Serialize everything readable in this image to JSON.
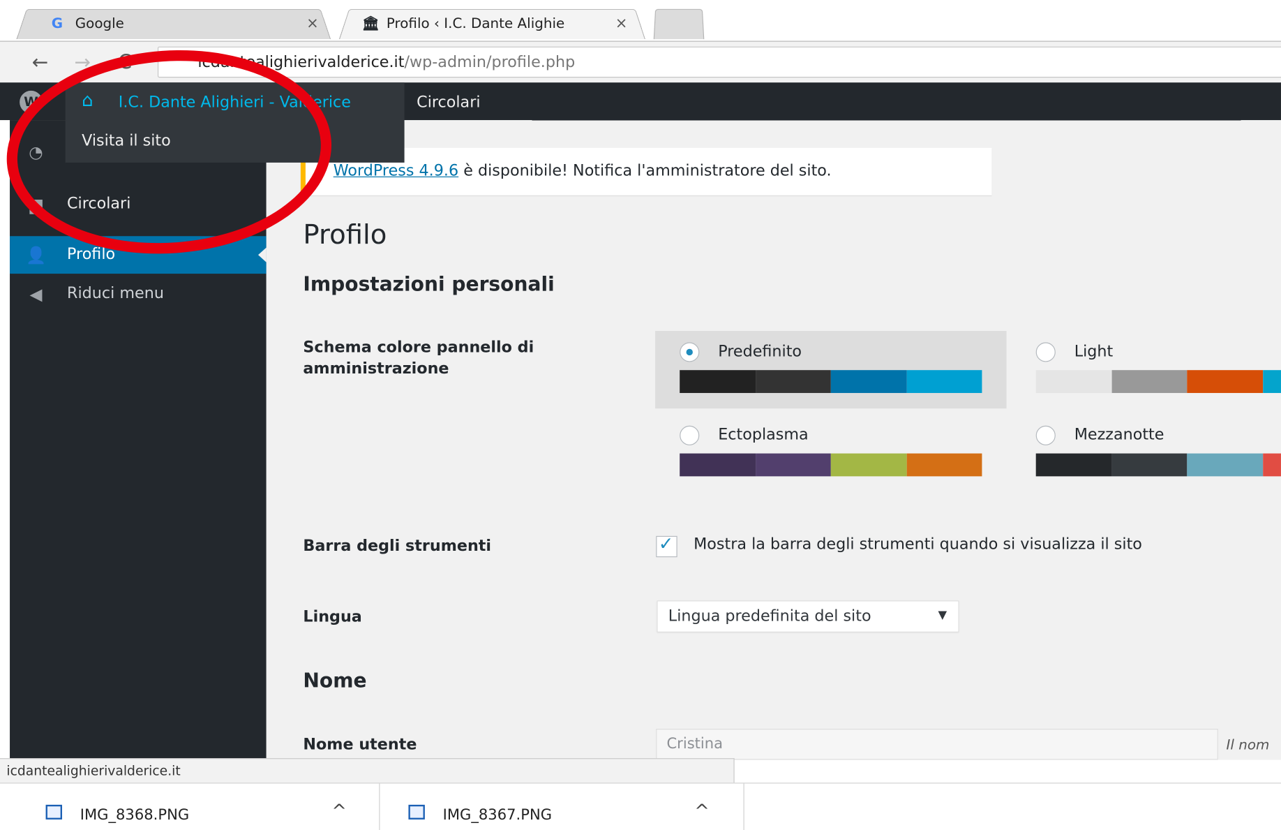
{
  "browser": {
    "tabs": [
      {
        "favicon": "G",
        "title": "Google",
        "close": "×"
      },
      {
        "favicon": "🏛",
        "title": "Profilo ‹ I.C. Dante Alighie",
        "close": "×"
      }
    ],
    "nav": {
      "back": "←",
      "forward": "→",
      "reload": "C"
    },
    "url_host": "icdantealighierivalderice.it",
    "url_path": "/wp-admin/profile.php"
  },
  "adminbar": {
    "wp_logo": "W",
    "site_name": "I.C. Dante Alighieri - Valderice",
    "visit_site": "Visita il sito",
    "circolari": "Circolari"
  },
  "sidebar": {
    "items": [
      {
        "icon": "dashboard-icon",
        "glyph": "◔",
        "label": ""
      },
      {
        "icon": "posts-icon",
        "glyph": "▆",
        "label": "Circolari"
      },
      {
        "icon": "user-icon",
        "glyph": "👤",
        "label": "Profilo"
      },
      {
        "icon": "collapse-icon",
        "glyph": "◀",
        "label": "Riduci menu"
      }
    ]
  },
  "main": {
    "notice_link": "WordPress 4.9.6",
    "notice_text": " è disponibile! Notifica l'amministratore del sito.",
    "page_title": "Profilo",
    "section_personal": "Impostazioni personali",
    "scheme_label": "Schema colore pannello di amministrazione",
    "schemes": [
      {
        "name": "Predefinito",
        "selected": true,
        "colors": [
          "#222222",
          "#333333",
          "#0073aa",
          "#00a0d2"
        ]
      },
      {
        "name": "Light",
        "selected": false,
        "colors": [
          "#e5e5e5",
          "#999999",
          "#d64e07",
          "#04a4cc"
        ]
      },
      {
        "name": "Ectoplasma",
        "selected": false,
        "colors": [
          "#413256",
          "#523f6d",
          "#a3b745",
          "#d46f15"
        ]
      },
      {
        "name": "Mezzanotte",
        "selected": false,
        "colors": [
          "#25282b",
          "#363b3f",
          "#69a8bb",
          "#e14d43"
        ]
      }
    ],
    "toolbar_label": "Barra degli strumenti",
    "toolbar_checkbox": "Mostra la barra degli strumenti quando si visualizza il sito",
    "language_label": "Lingua",
    "language_value": "Lingua predefinita del sito",
    "language_arrow": "▼",
    "section_name": "Nome",
    "username_label": "Nome utente",
    "username_value": "Cristina",
    "username_hint": "Il nom"
  },
  "status": "icdantealighierivalderice.it",
  "downloads": [
    {
      "name": "IMG_8368.PNG",
      "caret": "^"
    },
    {
      "name": "IMG_8367.PNG",
      "caret": "^"
    }
  ],
  "colors": {
    "annotation": "#e8000f",
    "admin_bar": "#23282d",
    "accent": "#0073aa",
    "link": "#00b9eb"
  }
}
